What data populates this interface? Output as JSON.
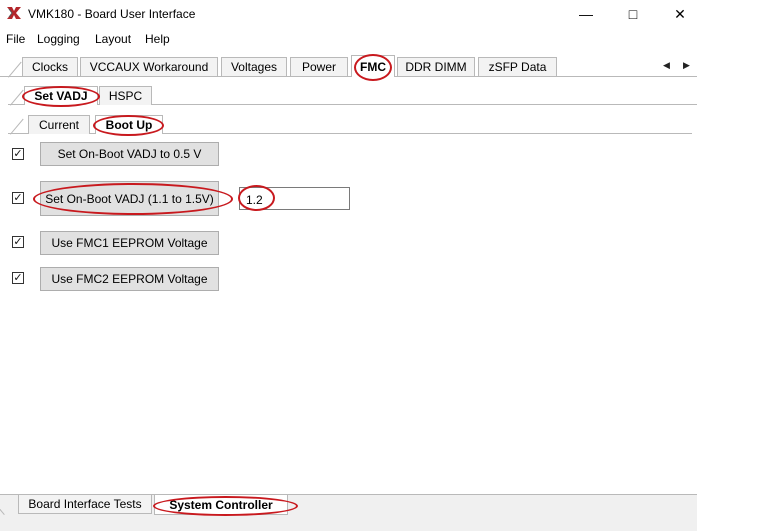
{
  "window": {
    "title": "VMK180 - Board User Interface",
    "controls": {
      "minimize": "—",
      "maximize": "□",
      "close": "✕"
    }
  },
  "menu": [
    "File",
    "Logging",
    "Layout",
    "Help"
  ],
  "top_tabs": [
    {
      "label": "Clocks"
    },
    {
      "label": "VCCAUX Workaround"
    },
    {
      "label": "Voltages"
    },
    {
      "label": "Power"
    },
    {
      "label": "FMC",
      "selected": true
    },
    {
      "label": "DDR DIMM"
    },
    {
      "label": "zSFP Data"
    }
  ],
  "tab_scroll": {
    "left": "◀",
    "right": "▶"
  },
  "sub_tabs": [
    {
      "label": "Set VADJ",
      "selected": true
    },
    {
      "label": "HSPC"
    }
  ],
  "sub_sub_tabs": [
    {
      "label": "Current"
    },
    {
      "label": "Boot Up",
      "selected": true
    }
  ],
  "options": [
    {
      "checked": true,
      "label": "Set On-Boot VADJ to 0.5 V"
    },
    {
      "checked": true,
      "label": "Set On-Boot VADJ (1.1 to 1.5V)"
    },
    {
      "checked": true,
      "label": "Use FMC1 EEPROM Voltage"
    },
    {
      "checked": true,
      "label": "Use FMC2 EEPROM Voltage"
    }
  ],
  "vadj_input": {
    "value": "1.2"
  },
  "check_glyph": "✓",
  "bottom_tabs": [
    {
      "label": "Board Interface Tests"
    },
    {
      "label": "System Controller",
      "selected": true
    }
  ],
  "highlight_color": "#c8191e"
}
